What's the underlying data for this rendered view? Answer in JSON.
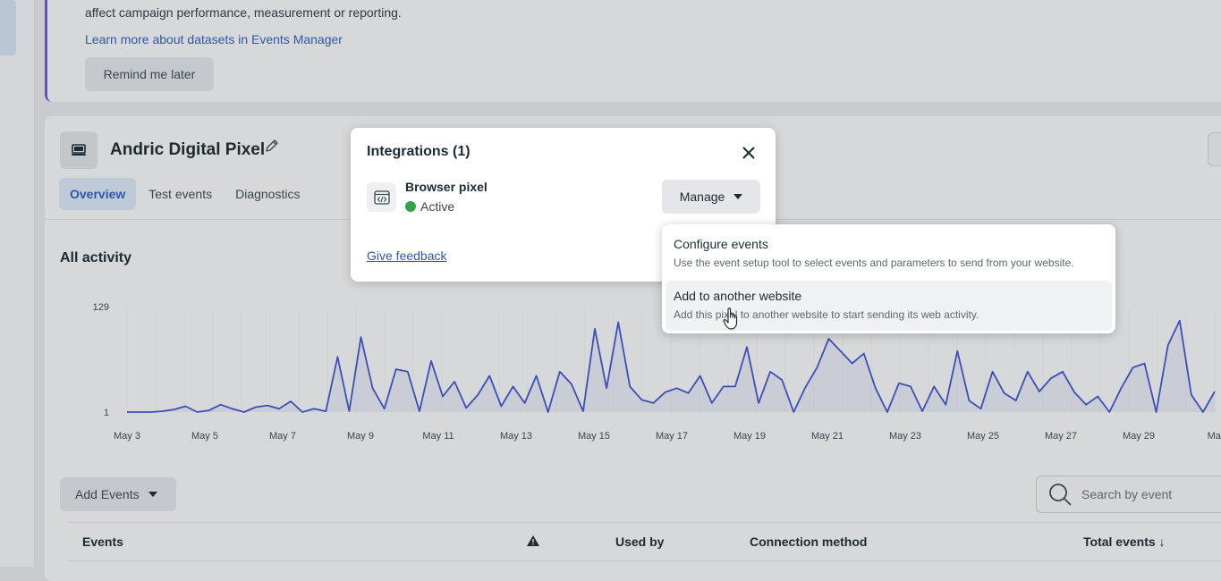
{
  "notice": {
    "text": "affect campaign performance, measurement or reporting.",
    "link": "Learn more about datasets in Events Manager",
    "remind_label": "Remind me later"
  },
  "pixel": {
    "title": "Andric Digital Pixel",
    "tabs": [
      {
        "label": "Overview",
        "active": true
      },
      {
        "label": "Test events",
        "active": false
      },
      {
        "label": "Diagnostics",
        "active": false
      }
    ]
  },
  "activity": {
    "title": "All activity"
  },
  "chart_data": {
    "type": "area",
    "ylim": [
      1,
      129
    ],
    "yticks": [
      "129",
      "1"
    ],
    "xticks": [
      "May 3",
      "May 5",
      "May 7",
      "May 9",
      "May 11",
      "May 13",
      "May 15",
      "May 17",
      "May 19",
      "May 21",
      "May 23",
      "May 25",
      "May 27",
      "May 29",
      "May"
    ],
    "color": "#3b4fb5",
    "values": [
      1,
      1,
      1,
      2,
      4,
      8,
      1,
      3,
      10,
      5,
      1,
      7,
      9,
      5,
      14,
      1,
      5,
      2,
      68,
      2,
      92,
      30,
      5,
      53,
      50,
      2,
      63,
      20,
      38,
      6,
      22,
      45,
      8,
      32,
      12,
      45,
      1,
      50,
      35,
      2,
      102,
      30,
      110,
      32,
      16,
      12,
      25,
      30,
      24,
      45,
      12,
      32,
      32,
      80,
      12,
      50,
      40,
      1,
      31,
      55,
      90,
      75,
      60,
      72,
      30,
      1,
      36,
      32,
      2,
      32,
      10,
      75,
      15,
      5,
      50,
      24,
      15,
      50,
      26,
      42,
      50,
      25,
      10,
      20,
      1,
      30,
      55,
      60,
      1,
      82,
      112,
      22,
      1,
      26
    ]
  },
  "events": {
    "add_label": "Add Events",
    "search_placeholder": "Search by event",
    "columns": [
      "Events",
      "Used by",
      "Connection method",
      "Total events ↓"
    ]
  },
  "modal": {
    "title": "Integrations (1)",
    "integration_name": "Browser pixel",
    "integration_status": "Active",
    "status_color": "#31a24c",
    "manage_label": "Manage",
    "feedback_label": "Give feedback"
  },
  "dropdown": {
    "items": [
      {
        "label": "Configure events",
        "desc": "Use the event setup tool to select events and parameters to send from your website."
      },
      {
        "label": "Add to another website",
        "desc": "Add this pixel to another website to start sending its web activity."
      }
    ]
  }
}
